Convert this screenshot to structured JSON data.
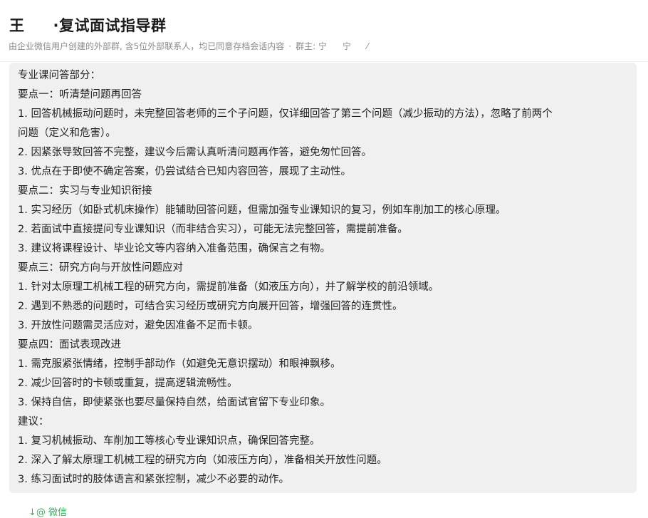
{
  "header": {
    "title_part1": "王",
    "title_part2": "·复试面试指导群",
    "subtitle_main": "由企业微信用户创建的外部群, 含5位外部联系人，均已同意存档会话内容",
    "subtitle_sep": "·",
    "owner_label": "群主: 宁",
    "owner_suffix": "宁",
    "owner_mark": "⁄"
  },
  "message": {
    "lines": [
      "专业课问答部分：",
      "要点一：听清楚问题再回答",
      "1. 回答机械振动问题时，未完整回答老师的三个子问题，仅详细回答了第三个问题（减少振动的方法），忽略了前两个",
      "问题（定义和危害）。",
      "2. 因紧张导致回答不完整，建议今后需认真听清问题再作答，避免匆忙回答。",
      "3. 优点在于即使不确定答案，仍尝试结合已知内容回答，展现了主动性。",
      "要点二：实习与专业知识衔接",
      "1. 实习经历（如卧式机床操作）能辅助回答问题，但需加强专业课知识的复习，例如车削加工的核心原理。",
      "2. 若面试中直接提问专业课知识（而非结合实习），可能无法完整回答，需提前准备。",
      "3. 建议将课程设计、毕业论文等内容纳入准备范围，确保言之有物。",
      "要点三：研究方向与开放性问题应对",
      "1. 针对太原理工机械工程的研究方向，需提前准备（如液压方向），并了解学校的前沿领域。",
      "2. 遇到不熟悉的问题时，可结合实习经历或研究方向展开回答，增强回答的连贯性。",
      "3. 开放性问题需灵活应对，避免因准备不足而卡顿。",
      "要点四：面试表现改进",
      "1. 需克服紧张情绪，控制手部动作（如避免无意识摆动）和眼神飘移。",
      "2. 减少回答时的卡顿或重复，提高逻辑流畅性。",
      "3. 保持自信，即使紧张也要尽量保持自然，给面试官留下专业印象。",
      "建议：",
      "1. 复习机械振动、车削加工等核心专业课知识点，确保回答完整。",
      "2. 深入了解太原理工机械工程的研究方向（如液压方向），准备相关开放性问题。",
      "3. 练习面试时的肢体语言和紧张控制，减少不必要的动作。"
    ]
  },
  "footer": {
    "source_text": "↓@ 微信"
  },
  "colors": {
    "bubble_bg": "#f0f0f0",
    "wechat_green": "#3fae61",
    "subtitle_gray": "#8a8a8a"
  }
}
